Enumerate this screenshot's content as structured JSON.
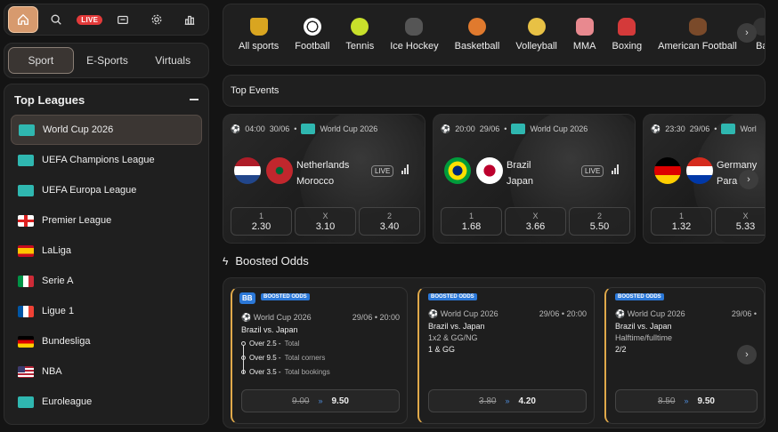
{
  "nav": {
    "live_label": "LIVE"
  },
  "tabs": [
    "Sport",
    "E-Sports",
    "Virtuals"
  ],
  "leagues": {
    "title": "Top Leagues",
    "items": [
      "World Cup 2026",
      "UEFA Champions League",
      "UEFA Europa League",
      "Premier League",
      "LaLiga",
      "Serie A",
      "Ligue 1",
      "Bundesliga",
      "NBA",
      "Euroleague"
    ]
  },
  "sports": [
    "All sports",
    "Football",
    "Tennis",
    "Ice Hockey",
    "Basketball",
    "Volleyball",
    "MMA",
    "Boxing",
    "American Football",
    "Ba"
  ],
  "top_events_title": "Top Events",
  "events": [
    {
      "time": "04:00",
      "date": "30/06",
      "competition": "World Cup 2026",
      "home": "Netherlands",
      "away": "Morocco",
      "live": "LIVE",
      "odds": [
        {
          "label": "1",
          "value": "2.30"
        },
        {
          "label": "X",
          "value": "3.10"
        },
        {
          "label": "2",
          "value": "3.40"
        }
      ]
    },
    {
      "time": "20:00",
      "date": "29/06",
      "competition": "World Cup 2026",
      "home": "Brazil",
      "away": "Japan",
      "live": "LIVE",
      "odds": [
        {
          "label": "1",
          "value": "1.68"
        },
        {
          "label": "X",
          "value": "3.66"
        },
        {
          "label": "2",
          "value": "5.50"
        }
      ]
    },
    {
      "time": "23:30",
      "date": "29/06",
      "competition": "Worl",
      "home": "Germany",
      "away": "Para",
      "live": "",
      "odds": [
        {
          "label": "1",
          "value": "1.32"
        },
        {
          "label": "X",
          "value": "5.33"
        },
        {
          "label": "",
          "value": ""
        }
      ]
    }
  ],
  "boosted": {
    "title": "Boosted Odds",
    "cards": [
      {
        "bb": "BB",
        "tag": "BOOSTED ODDS",
        "competition": "World Cup 2026",
        "datetime": "29/06 • 20:00",
        "match": "Brazil vs. Japan",
        "legs": [
          {
            "main": "Over 2.5 -",
            "sub": "Total"
          },
          {
            "main": "Over 9.5 -",
            "sub": "Total corners"
          },
          {
            "main": "Over 3.5 -",
            "sub": "Total bookings"
          }
        ],
        "old": "9.00",
        "new": "9.50"
      },
      {
        "tag": "BOOSTED ODDS",
        "competition": "World Cup 2026",
        "datetime": "29/06 • 20:00",
        "match": "Brazil vs. Japan",
        "market": "1x2 & GG/NG",
        "selection": "1 & GG",
        "old": "3.80",
        "new": "4.20"
      },
      {
        "tag": "BOOSTED ODDS",
        "competition": "World Cup 2026",
        "datetime": "29/06 •",
        "match": "Brazil vs. Japan",
        "market": "Halftime/fulltime",
        "selection": "2/2",
        "old": "8.50",
        "new": "9.50"
      }
    ]
  }
}
